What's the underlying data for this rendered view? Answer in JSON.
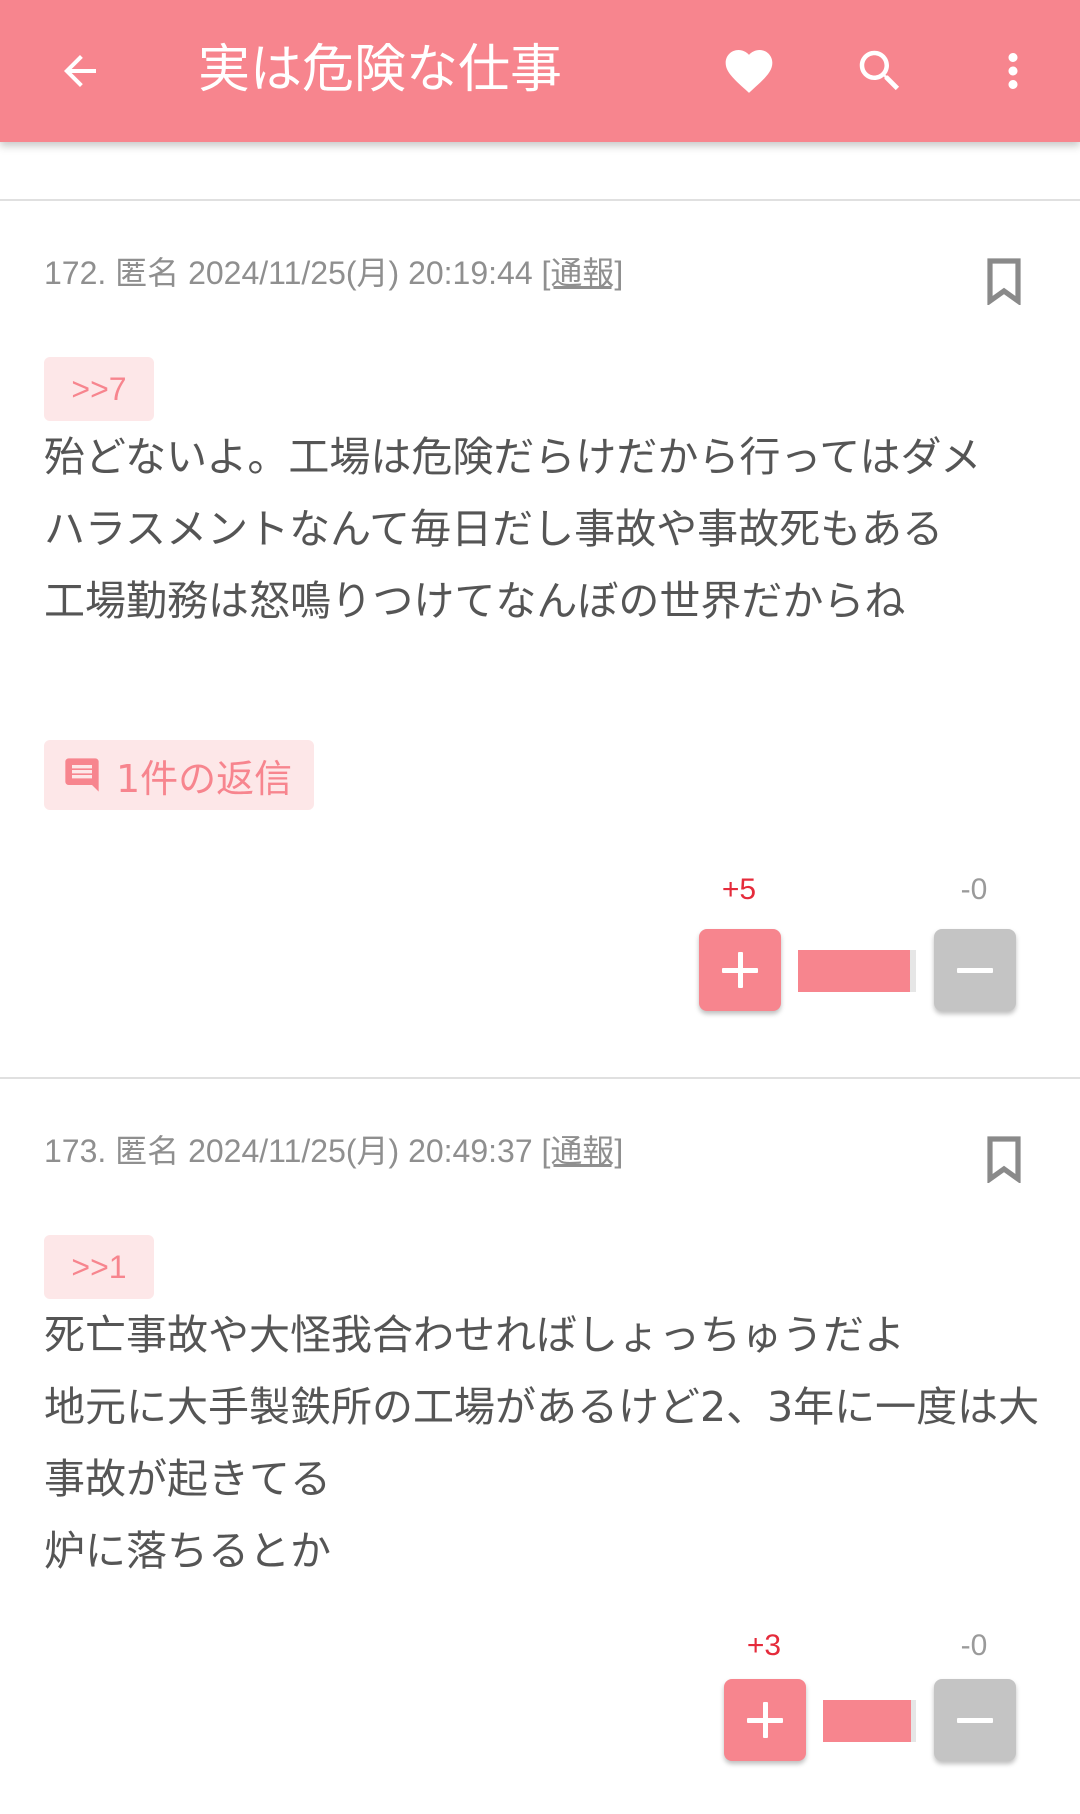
{
  "appbar": {
    "title": "実は危険な仕事",
    "back_icon": "arrow-left-icon",
    "favorite_icon": "heart-icon",
    "search_icon": "search-icon",
    "more_icon": "more-vertical-icon"
  },
  "colors": {
    "accent": "#f7858e",
    "accent_light": "#fde7e8",
    "plus_score": "#e52b3b",
    "minus_score": "#9a9a9a",
    "text": "#555555",
    "meta": "#8f8f8f"
  },
  "posts": [
    {
      "number": "172.",
      "author": "匿名",
      "datetime": "2024/11/25(月) 20:19:44",
      "report_label": "[通報]",
      "anchor": ">>7",
      "body": "殆どないよ。工場は危険だらけだから行ってはダメ\nハラスメントなんて毎日だし事故や事故死もある\n工場勤務は怒鳴りつけてなんぼの世界だからね",
      "reply_label": "1件の返信",
      "plus_score": "+5",
      "minus_score": "-0",
      "plus_ratio": 0.95
    },
    {
      "number": "173.",
      "author": "匿名",
      "datetime": "2024/11/25(月) 20:49:37",
      "report_label": "[通報]",
      "anchor": ">>1",
      "body": "死亡事故や大怪我合わせればしょっちゅうだよ\n地元に大手製鉄所の工場があるけど2、3年に一度は大事故が起きてる\n炉に落ちるとか",
      "plus_score": "+3",
      "minus_score": "-0",
      "plus_ratio": 0.95
    }
  ]
}
